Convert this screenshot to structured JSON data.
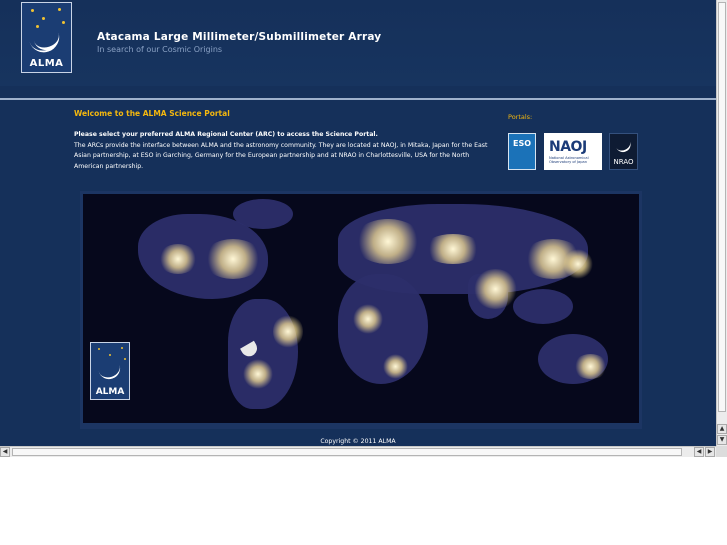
{
  "header": {
    "logo_text": "ALMA",
    "title": "Atacama Large Millimeter/Submillimeter Array",
    "subtitle": "In search of our Cosmic Origins"
  },
  "welcome": {
    "heading": "Welcome to the ALMA Science Portal",
    "lead": "Please select your preferred ALMA Regional Center (ARC) to access the Science Portal.",
    "body": "The ARCs provide the interface between ALMA and the astronomy community. They are located at NAOJ, in Mitaka, Japan for the East Asian partnership, at ESO in Garching, Germany for the European partnership and at NRAO in Charlottesville, USA for the North American partnership."
  },
  "portals": {
    "label": "Portals:",
    "items": [
      {
        "name": "ESO",
        "text": "ESO"
      },
      {
        "name": "NAOJ",
        "text": "NAOJ",
        "subtext": "National Astronomical Observatory of Japan"
      },
      {
        "name": "NRAO",
        "text": "NRAO"
      }
    ]
  },
  "map": {
    "logo_text": "ALMA"
  },
  "footer": {
    "copyright": "Copyright © 2011 ALMA"
  },
  "scrollbars": {
    "up_icon": "arrow-up-icon",
    "down_icon": "arrow-down-icon",
    "left_icon": "arrow-left-icon",
    "right_icon": "arrow-right-icon"
  },
  "colors": {
    "background": "#15305a",
    "accent": "#f3b70f",
    "rule": "#9fb1cc"
  }
}
